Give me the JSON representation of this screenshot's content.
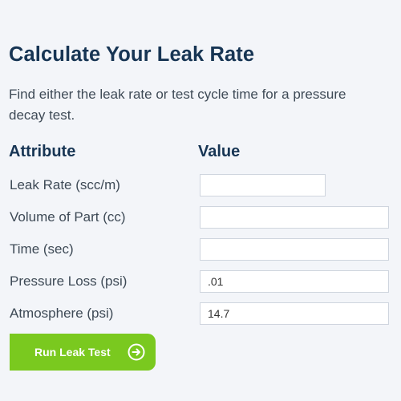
{
  "calculator": {
    "title": "Calculate Your Leak Rate",
    "description": "Find either the leak rate or test cycle time for a pressure decay test.",
    "columns": {
      "attribute": "Attribute",
      "value": "Value"
    },
    "rows": [
      {
        "label": "Leak Rate (scc/m)",
        "value": ""
      },
      {
        "label": "Volume of Part (cc)",
        "value": ""
      },
      {
        "label": "Time (sec)",
        "value": ""
      },
      {
        "label": "Pressure Loss (psi)",
        "value": ".01"
      },
      {
        "label": "Atmosphere (psi)",
        "value": "14.7"
      }
    ],
    "run_button": {
      "label": "Run Leak Test",
      "icon": "arrow-right-circle-icon"
    },
    "colors": {
      "heading": "#173554",
      "text": "#3e4a56",
      "button": "#7ac91f",
      "background": "#f3f5f9"
    }
  }
}
